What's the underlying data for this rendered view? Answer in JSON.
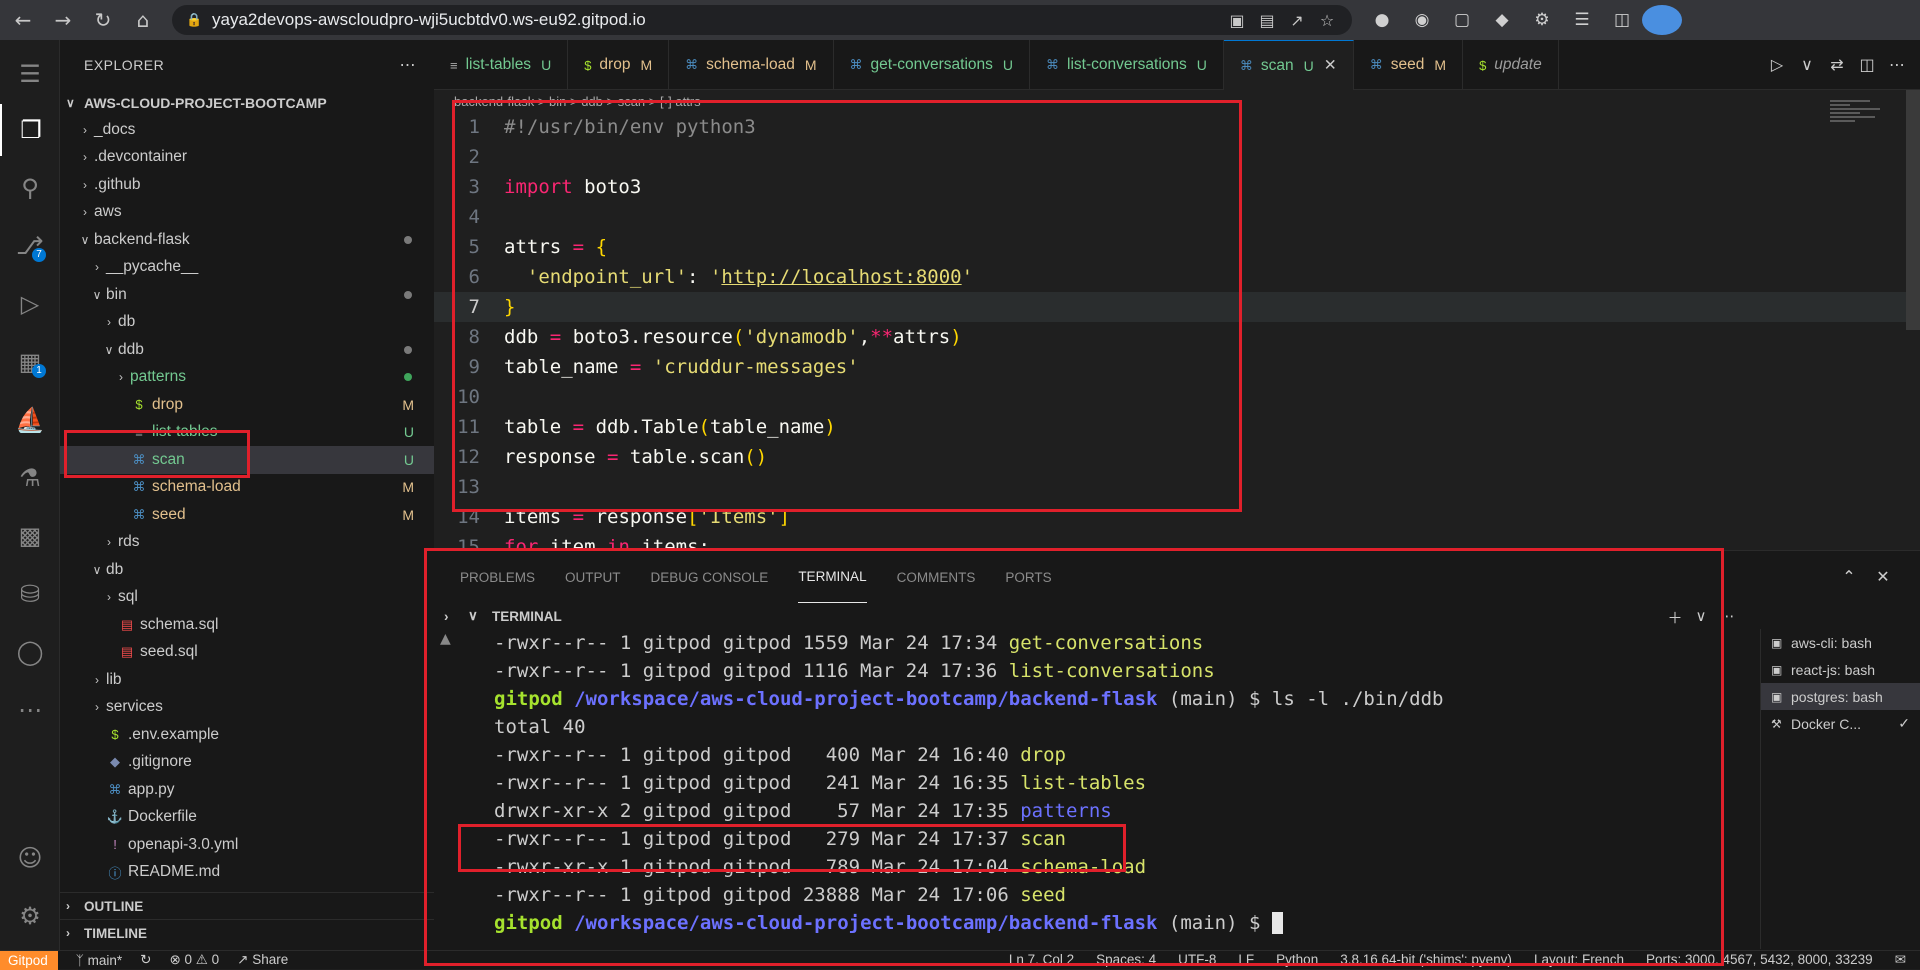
{
  "browser": {
    "url": "yaya2devops-awscloudpro-wji5ucbtdv0.ws-eu92.gitpod.io"
  },
  "activity_badges": {
    "scm": "7",
    "extensions": "1"
  },
  "explorer": {
    "title": "EXPLORER",
    "project": "AWS-CLOUD-PROJECT-BOOTCAMP",
    "items": [
      {
        "label": "_docs",
        "kind": "folder",
        "depth": 1,
        "open": false,
        "status": ""
      },
      {
        "label": ".devcontainer",
        "kind": "folder",
        "depth": 1,
        "open": false,
        "status": ""
      },
      {
        "label": ".github",
        "kind": "folder",
        "depth": 1,
        "open": false,
        "status": ""
      },
      {
        "label": "aws",
        "kind": "folder",
        "depth": 1,
        "open": false,
        "status": ""
      },
      {
        "label": "backend-flask",
        "kind": "folder",
        "depth": 1,
        "open": true,
        "status": "dot"
      },
      {
        "label": "__pycache__",
        "kind": "folder",
        "depth": 2,
        "open": false,
        "status": ""
      },
      {
        "label": "bin",
        "kind": "folder",
        "depth": 2,
        "open": true,
        "status": "dot"
      },
      {
        "label": "db",
        "kind": "folder",
        "depth": 3,
        "open": false,
        "status": ""
      },
      {
        "label": "ddb",
        "kind": "folder",
        "depth": 3,
        "open": true,
        "status": "dot"
      },
      {
        "label": "patterns",
        "kind": "folder",
        "depth": 4,
        "open": false,
        "status": "greendot"
      },
      {
        "label": "drop",
        "kind": "shell",
        "depth": 4,
        "open": false,
        "status": "M"
      },
      {
        "label": "list-tables",
        "kind": "text",
        "depth": 4,
        "open": false,
        "status": "U"
      },
      {
        "label": "scan",
        "kind": "python",
        "depth": 4,
        "open": false,
        "status": "U",
        "selected": true
      },
      {
        "label": "schema-load",
        "kind": "python",
        "depth": 4,
        "open": false,
        "status": "M"
      },
      {
        "label": "seed",
        "kind": "python",
        "depth": 4,
        "open": false,
        "status": "M"
      },
      {
        "label": "rds",
        "kind": "folder",
        "depth": 3,
        "open": false,
        "status": ""
      },
      {
        "label": "db",
        "kind": "folder",
        "depth": 2,
        "open": true,
        "status": ""
      },
      {
        "label": "sql",
        "kind": "folder",
        "depth": 3,
        "open": false,
        "status": ""
      },
      {
        "label": "schema.sql",
        "kind": "sql",
        "depth": 3,
        "open": false,
        "status": ""
      },
      {
        "label": "seed.sql",
        "kind": "sql",
        "depth": 3,
        "open": false,
        "status": ""
      },
      {
        "label": "lib",
        "kind": "folder",
        "depth": 2,
        "open": false,
        "status": ""
      },
      {
        "label": "services",
        "kind": "folder",
        "depth": 2,
        "open": false,
        "status": ""
      },
      {
        "label": ".env.example",
        "kind": "shell",
        "depth": 2,
        "open": false,
        "status": ""
      },
      {
        "label": ".gitignore",
        "kind": "git",
        "depth": 2,
        "open": false,
        "status": ""
      },
      {
        "label": "app.py",
        "kind": "python",
        "depth": 2,
        "open": false,
        "status": ""
      },
      {
        "label": "Dockerfile",
        "kind": "docker",
        "depth": 2,
        "open": false,
        "status": ""
      },
      {
        "label": "openapi-3.0.yml",
        "kind": "yaml",
        "depth": 2,
        "open": false,
        "status": ""
      },
      {
        "label": "README.md",
        "kind": "info",
        "depth": 2,
        "open": false,
        "status": ""
      }
    ],
    "outline": "OUTLINE",
    "timeline": "TIMELINE"
  },
  "tabs": [
    {
      "label": "list-tables",
      "icon": "text",
      "status": "U"
    },
    {
      "label": "drop",
      "icon": "shell",
      "status": "M"
    },
    {
      "label": "schema-load",
      "icon": "python",
      "status": "M"
    },
    {
      "label": "get-conversations",
      "icon": "python",
      "status": "U"
    },
    {
      "label": "list-conversations",
      "icon": "python",
      "status": "U"
    },
    {
      "label": "scan",
      "icon": "python",
      "status": "U",
      "active": true
    },
    {
      "label": "seed",
      "icon": "python",
      "status": "M"
    },
    {
      "label": "update",
      "icon": "shell",
      "status": ""
    }
  ],
  "breadcrumb": "backend-flask > bin > ddb > scan > [•] attrs",
  "code_lines": [
    "#!/usr/bin/env python3",
    "",
    "import boto3",
    "",
    "attrs = {",
    "  'endpoint_url': 'http://localhost:8000'",
    "}",
    "ddb = boto3.resource('dynamodb',**attrs)",
    "table_name = 'cruddur-messages'",
    "",
    "table = ddb.Table(table_name)",
    "response = table.scan()",
    "",
    "items = response['Items']",
    "for item in items:"
  ],
  "panel": {
    "tabs": [
      "PROBLEMS",
      "OUTPUT",
      "DEBUG CONSOLE",
      "TERMINAL",
      "COMMENTS",
      "PORTS"
    ],
    "active_tab": "TERMINAL",
    "section": "TERMINAL"
  },
  "terminal_lines": [
    {
      "meta": "-rwxr--r-- 1 gitpod gitpod 1559 Mar 24 17:34 ",
      "name": "get-conversations"
    },
    {
      "meta": "-rwxr--r-- 1 gitpod gitpod 1116 Mar 24 17:36 ",
      "name": "list-conversations"
    },
    {
      "prompt": "gitpod",
      "path": "/workspace/aws-cloud-project-bootcamp/backend-flask",
      "branch": " (main) $ ls -l ./bin/ddb"
    },
    {
      "meta": "total 40",
      "name": ""
    },
    {
      "meta": "-rwxr--r-- 1 gitpod gitpod   400 Mar 24 16:40 ",
      "name": "drop"
    },
    {
      "meta": "-rwxr--r-- 1 gitpod gitpod   241 Mar 24 16:35 ",
      "name": "list-tables"
    },
    {
      "meta": "drwxr-xr-x 2 gitpod gitpod    57 Mar 24 17:35 ",
      "name": "patterns",
      "dir": true
    },
    {
      "meta": "-rwxr--r-- 1 gitpod gitpod   279 Mar 24 17:37 ",
      "name": "scan"
    },
    {
      "meta": "-rwxr-xr-x 1 gitpod gitpod   789 Mar 24 17:04 ",
      "name": "schema-load"
    },
    {
      "meta": "-rwxr--r-- 1 gitpod gitpod 23888 Mar 24 17:06 ",
      "name": "seed"
    },
    {
      "prompt": "gitpod",
      "path": "/workspace/aws-cloud-project-bootcamp/backend-flask",
      "branch": " (main) $ ",
      "cursor": true
    }
  ],
  "terminals": [
    {
      "label": "aws-cli: bash",
      "icon": "terminal"
    },
    {
      "label": "react-js: bash",
      "icon": "terminal"
    },
    {
      "label": "postgres: bash",
      "icon": "terminal",
      "active": true
    },
    {
      "label": "Docker C...",
      "icon": "tools",
      "check": true
    }
  ],
  "statusbar": {
    "remote": "Gitpod",
    "branch": "main*",
    "problems": "⊗ 0 ⚠ 0",
    "share": "Share",
    "position": "Ln 7, Col 2",
    "spaces": "Spaces: 4",
    "encoding": "UTF-8",
    "eol": "LF",
    "language": "Python",
    "interpreter": "3.8.16 64-bit ('shims': pyenv)",
    "layout": "Layout: French",
    "ports": "Ports: 3000, 4567, 5432, 8000, 33239"
  },
  "colors": {
    "accent": "#0078d4",
    "annotation": "#e0202b",
    "gitpod": "#ff8c2b"
  }
}
